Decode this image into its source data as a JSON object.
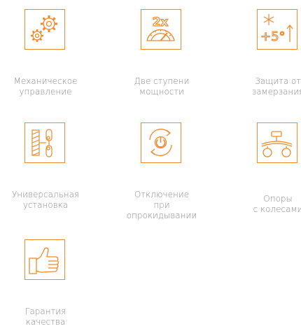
{
  "accent_color": "#f08a2c",
  "text_color": "#8c8c8c",
  "features": [
    {
      "icon": "gears-icon",
      "line1": "Механическое",
      "line2": "управление",
      "line3": ""
    },
    {
      "icon": "power-gauge-icon",
      "line1": "Две ступени",
      "line2": "мощности",
      "line3": ""
    },
    {
      "icon": "frost-protection-icon",
      "line1": "Защита от",
      "line2": "замерзания",
      "line3": ""
    },
    {
      "icon": "wall-mount-icon",
      "line1": "Универсальная",
      "line2": "установка",
      "line3": ""
    },
    {
      "icon": "power-refresh-icon",
      "line1": "Отключение",
      "line2": "при",
      "line3": "опрокидывании"
    },
    {
      "icon": "wheels-support-icon",
      "line1": "Опоры",
      "line2": "с колесами",
      "line3": ""
    },
    {
      "icon": "thumbs-up-icon",
      "line1": "Гарантия",
      "line2": "качества",
      "line3": ""
    }
  ],
  "gauge_text": "2x",
  "frost_text": "+5°"
}
